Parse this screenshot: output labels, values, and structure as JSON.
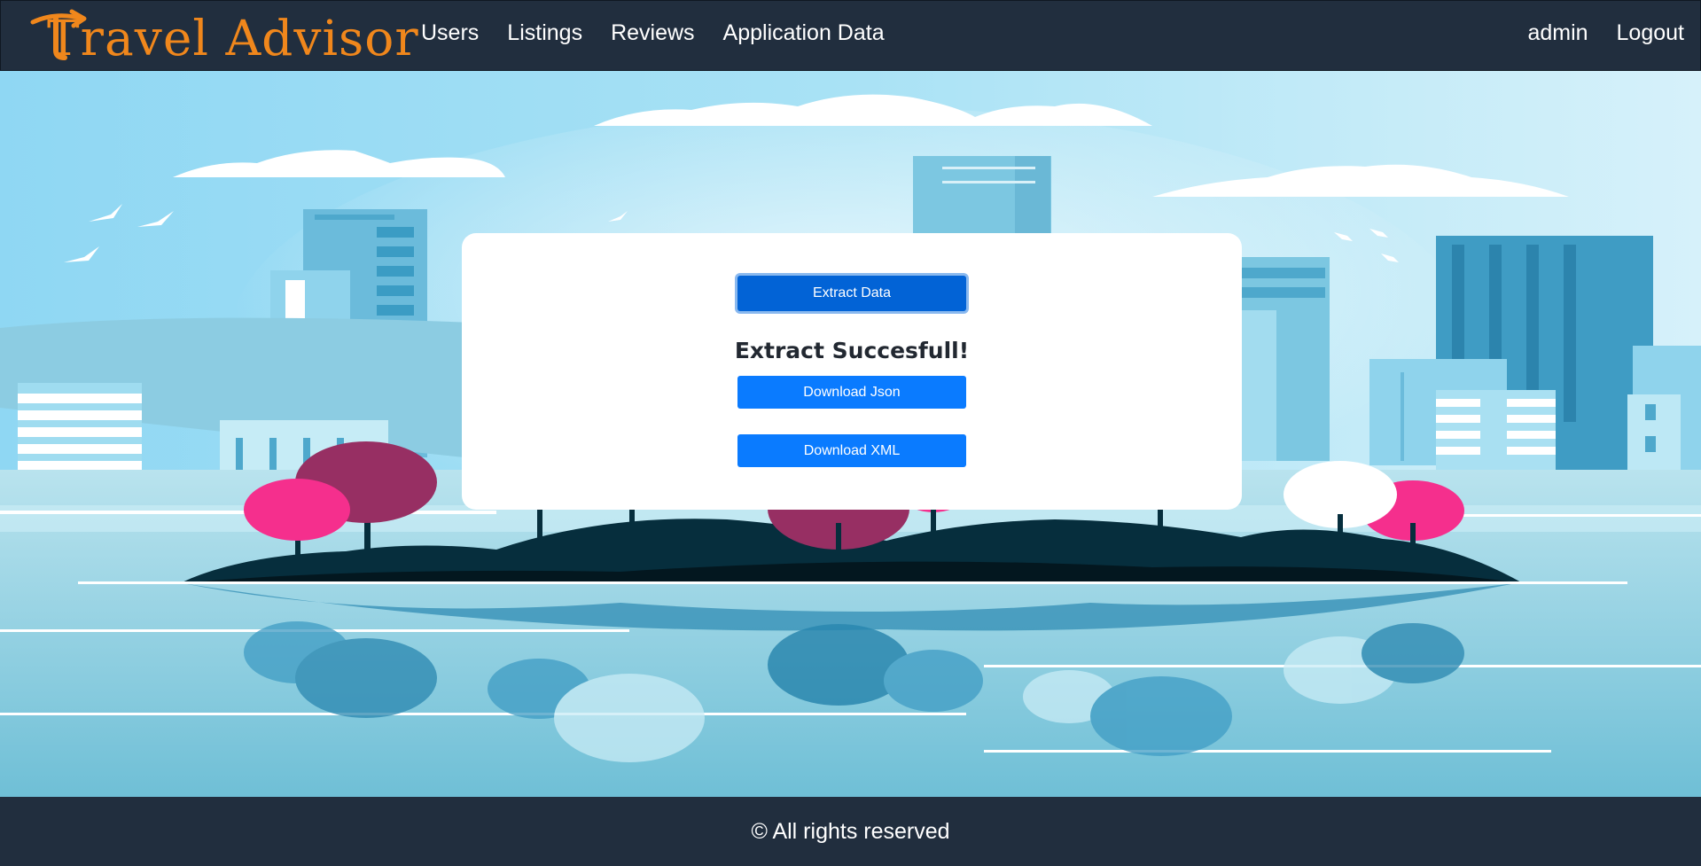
{
  "brand": {
    "name": "Travel Advisor",
    "icon": "plane-arrow-icon",
    "color": "#f0871c"
  },
  "nav": {
    "links": [
      "Users",
      "Listings",
      "Reviews",
      "Application Data"
    ],
    "user": "admin",
    "logout": "Logout"
  },
  "card": {
    "extract_label": "Extract Data",
    "success_text": "Extract Succesfull!",
    "download_json_label": "Download Json",
    "download_xml_label": "Download XML"
  },
  "footer": {
    "text": "© All rights reserved"
  },
  "colors": {
    "navbar": "#212e3e",
    "button": "#0a7bff",
    "button_active": "#0263d6",
    "sky": "#9fdff5"
  }
}
